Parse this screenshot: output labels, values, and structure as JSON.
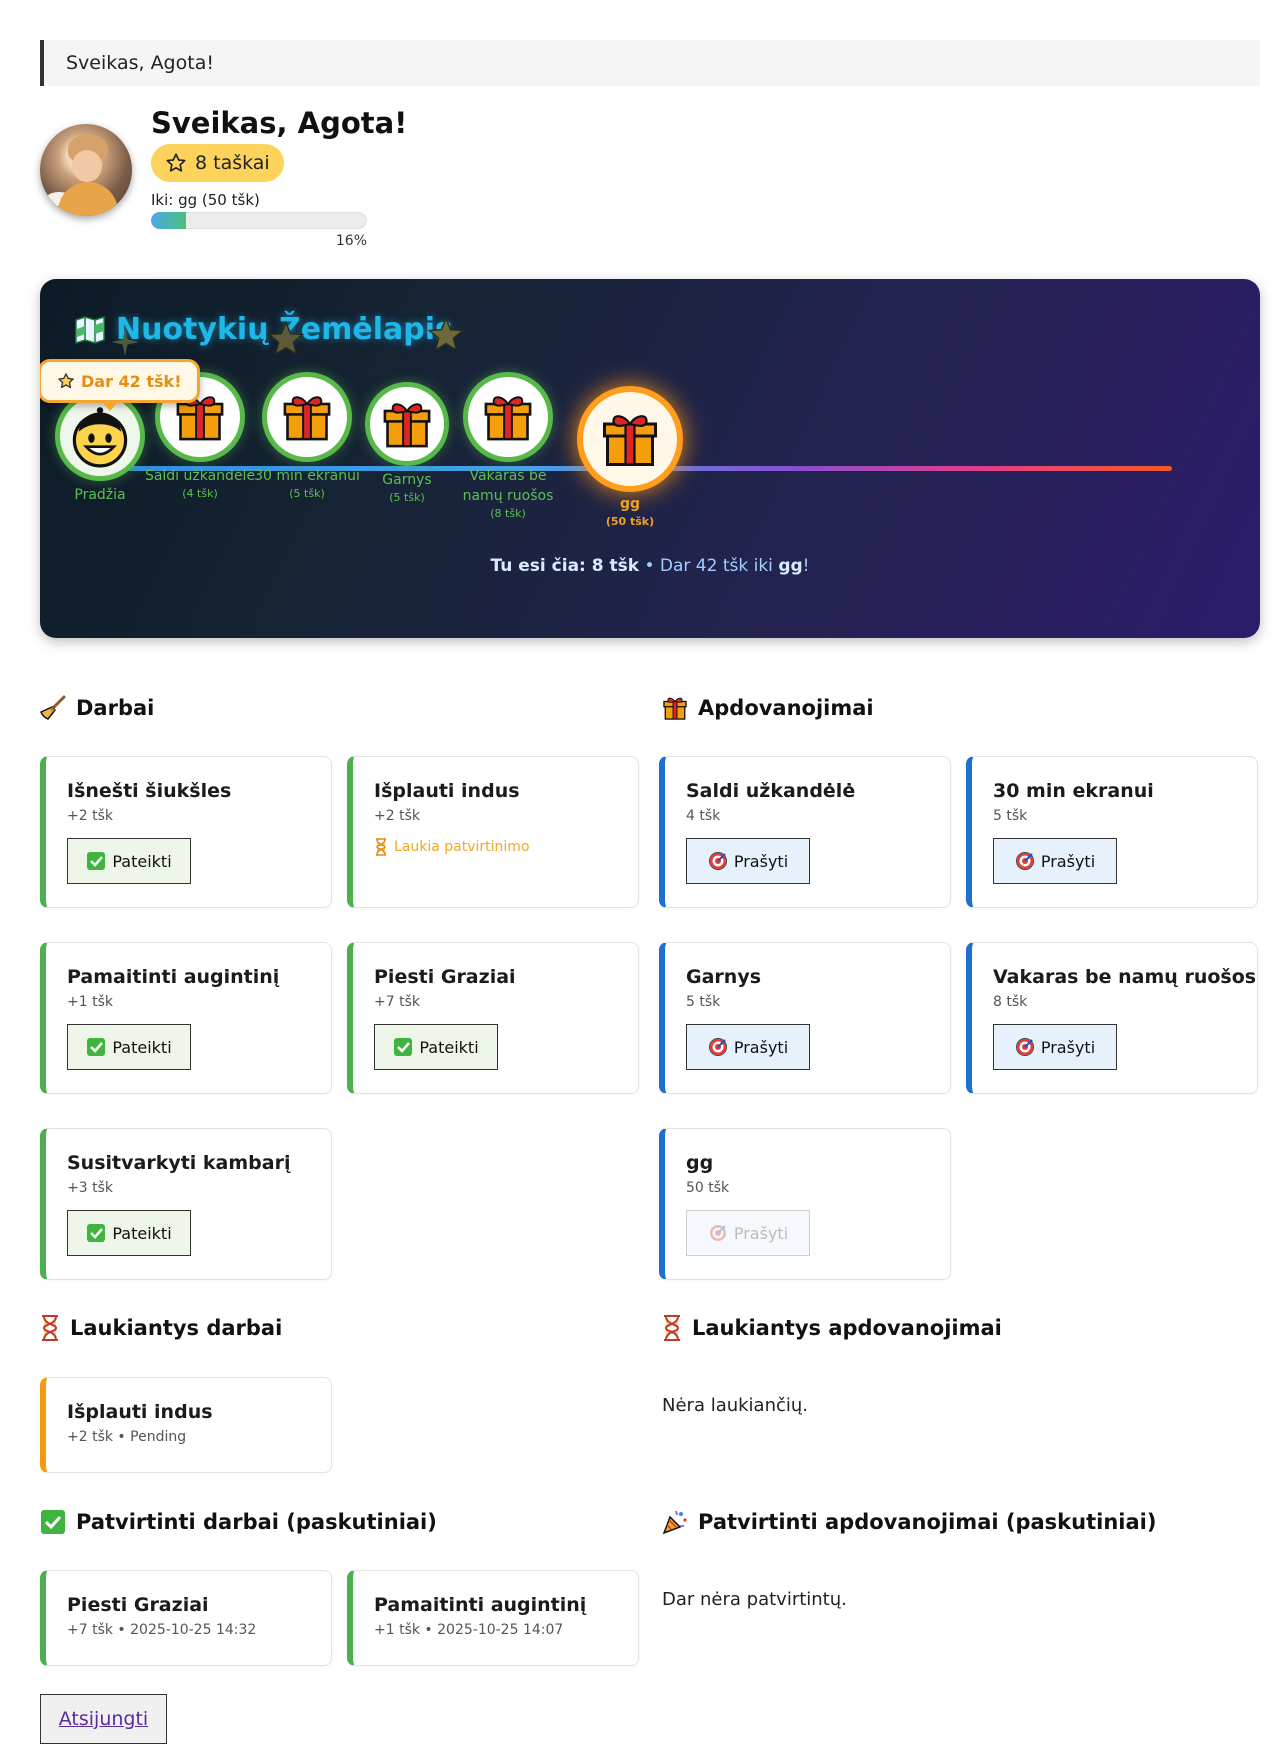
{
  "banner": {
    "text": "Sveikas, Agota!"
  },
  "profile": {
    "greeting": "Sveikas, Agota!",
    "points_label": "8 taškai",
    "goal_label": "Iki: gg (50 tšk)",
    "progress_percent": 16,
    "progress_text": "16%"
  },
  "map": {
    "title": "Nuotykių Žemėlapis",
    "bubble": "Dar 42 tšk!",
    "nodes": [
      {
        "label": "Pradžia",
        "cost": ""
      },
      {
        "label": "Saldi užkandėlė",
        "cost": "(4 tšk)"
      },
      {
        "label": "30 min ekranui",
        "cost": "(5 tšk)"
      },
      {
        "label": "Garnys",
        "cost": "(5 tšk)"
      },
      {
        "label": "Vakaras be namų ruošos",
        "cost": "(8 tšk)"
      },
      {
        "label": "gg",
        "cost": "(50 tšk)"
      }
    ],
    "footer_here": "Tu esi čia: 8 tšk",
    "footer_sep": " • ",
    "footer_rest": "Dar 42 tšk iki ",
    "footer_target": "gg",
    "footer_end": "!"
  },
  "chores": {
    "heading": "Darbai",
    "items": [
      {
        "title": "Išnešti šiukšles",
        "points": "+2 tšk",
        "button": "Pateikti"
      },
      {
        "title": "Išplauti indus",
        "points": "+2 tšk",
        "status": "Laukia patvirtinimo"
      },
      {
        "title": "Pamaitinti augintinį",
        "points": "+1 tšk",
        "button": "Pateikti"
      },
      {
        "title": "Piesti Graziai",
        "points": "+7 tšk",
        "button": "Pateikti"
      },
      {
        "title": "Susitvarkyti kambarį",
        "points": "+3 tšk",
        "button": "Pateikti"
      }
    ]
  },
  "rewards": {
    "heading": "Apdovanojimai",
    "items": [
      {
        "title": "Saldi užkandėlė",
        "cost": "4 tšk",
        "button": "Prašyti"
      },
      {
        "title": "30 min ekranui",
        "cost": "5 tšk",
        "button": "Prašyti"
      },
      {
        "title": "Garnys",
        "cost": "5 tšk",
        "button": "Prašyti"
      },
      {
        "title": "Vakaras be namų ruošos",
        "cost": "8 tšk",
        "button": "Prašyti"
      },
      {
        "title": "gg",
        "cost": "50 tšk",
        "button": "Prašyti",
        "disabled": true
      }
    ]
  },
  "pending_chores": {
    "heading": "Laukiantys darbai",
    "items": [
      {
        "title": "Išplauti indus",
        "meta": "+2 tšk • Pending"
      }
    ]
  },
  "pending_rewards": {
    "heading": "Laukiantys apdovanojimai",
    "empty": "Nėra laukiančių."
  },
  "approved_chores": {
    "heading": "Patvirtinti darbai (paskutiniai)",
    "items": [
      {
        "title": "Piesti Graziai",
        "meta": "+7 tšk • 2025-10-25 14:32"
      },
      {
        "title": "Pamaitinti augintinį",
        "meta": "+1 tšk • 2025-10-25 14:07"
      }
    ]
  },
  "approved_rewards": {
    "heading": "Patvirtinti apdovanojimai (paskutiniai)",
    "empty": "Dar nėra patvirtintų."
  },
  "logout": {
    "label": "Atsijungti"
  },
  "colors": {
    "accent_green": "#4caf50",
    "accent_blue": "#1f6fd1",
    "accent_orange": "#f59a12",
    "points_pill": "#fdd35c",
    "map_title": "#1fb6e8"
  }
}
